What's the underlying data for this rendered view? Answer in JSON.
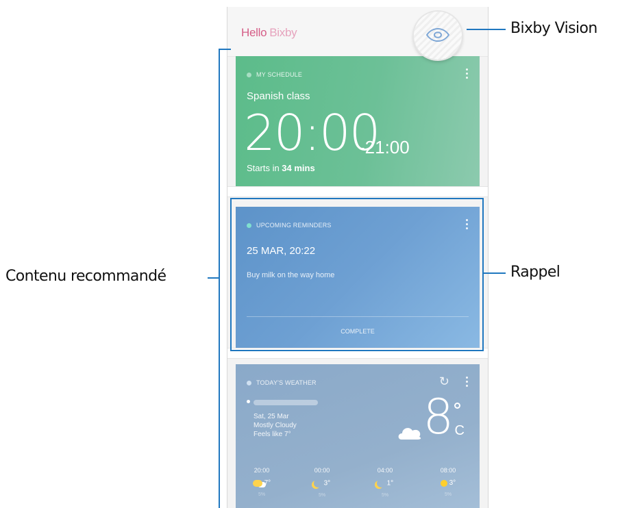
{
  "header": {
    "hello": "Hello",
    "bixby": "Bixby",
    "vision_icon": "eye-icon"
  },
  "schedule": {
    "tag": "MY SCHEDULE",
    "title": "Spanish class",
    "time": "20:00",
    "end": "-21:00",
    "starts_prefix": "Starts in ",
    "starts_value": "34 mins",
    "color": "#5cbc8a"
  },
  "reminders": {
    "tag": "UPCOMING REMINDERS",
    "date": "25 MAR, 20:22",
    "text": "Buy milk on the way home",
    "complete": "COMPLETE",
    "color": "#6a9fd2"
  },
  "weather": {
    "tag": "TODAY'S WEATHER",
    "date": "Sat, 25 Mar",
    "condition": "Mostly Cloudy",
    "feels": "Feels like 7°",
    "temp": "8",
    "unit": "C",
    "forecast": [
      {
        "time": "20:00",
        "temp": "7°",
        "icon": "moon-cloud-icon",
        "pct": "5%"
      },
      {
        "time": "00:00",
        "temp": "3°",
        "icon": "moon-icon",
        "pct": "5%"
      },
      {
        "time": "04:00",
        "temp": "1°",
        "icon": "moon-icon",
        "pct": "5%"
      },
      {
        "time": "08:00",
        "temp": "3°",
        "icon": "sun-icon",
        "pct": "5%"
      }
    ],
    "color": "#8fabc8"
  },
  "callouts": {
    "bixby_vision": "Bixby Vision",
    "recommended": "Contenu recommandé",
    "reminder": "Rappel",
    "line_color": "#1f77bf"
  }
}
